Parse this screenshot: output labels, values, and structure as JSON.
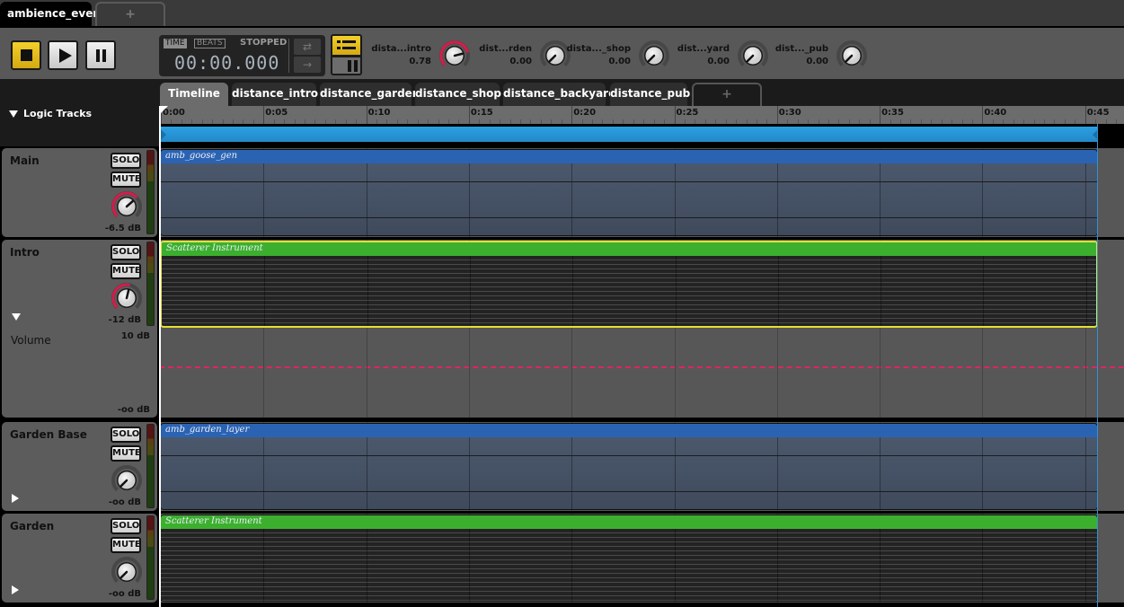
{
  "document_tabs": {
    "active": "ambience_event",
    "add_label": "+"
  },
  "transport": {
    "stop_icon": "stop-icon",
    "play_icon": "play-icon",
    "pause_icon": "pause-icon",
    "time_mode": "TIME",
    "beats_mode": "BEATS",
    "status": "STOPPED",
    "clock": "00:00.000",
    "loop_icon": "⇄",
    "forward_icon": "→"
  },
  "parameters": [
    {
      "name": "dista...intro",
      "value": "0.78",
      "fraction": 0.78,
      "active": true
    },
    {
      "name": "dist...rden",
      "value": "0.00",
      "fraction": 0.0,
      "active": false
    },
    {
      "name": "dista..._shop",
      "value": "0.00",
      "fraction": 0.0,
      "active": false
    },
    {
      "name": "dist...yard",
      "value": "0.00",
      "fraction": 0.0,
      "active": false
    },
    {
      "name": "dist..._pub",
      "value": "0.00",
      "fraction": 0.0,
      "active": false
    }
  ],
  "editor_tabs": [
    {
      "label": "Timeline",
      "active": true
    },
    {
      "label": "distance_intro"
    },
    {
      "label": "distance_garden"
    },
    {
      "label": "distance_shop"
    },
    {
      "label": "distance_backyard"
    },
    {
      "label": "distance_pub"
    },
    {
      "label": "+"
    }
  ],
  "logic_tracks_label": "Logic Tracks",
  "ruler": {
    "ticks": [
      "0:00",
      "0:05",
      "0:10",
      "0:15",
      "0:20",
      "0:25",
      "0:30",
      "0:35",
      "0:40",
      "0:45"
    ]
  },
  "tracks": [
    {
      "name": "Main",
      "solo": "SOLO",
      "mute": "MUTE",
      "volume": "-6.5 dB",
      "knob_fraction": 0.68,
      "expander": "none",
      "instrument": {
        "label": "amb_goose_gen",
        "kind": "audio"
      }
    },
    {
      "name": "Intro",
      "solo": "SOLO",
      "mute": "MUTE",
      "volume": "-12 dB",
      "knob_fraction": 0.55,
      "expander": "expanded",
      "instrument": {
        "label": "Scatterer Instrument",
        "kind": "scatterer",
        "selected": true
      }
    },
    {
      "name": "Garden Base",
      "solo": "SOLO",
      "mute": "MUTE",
      "volume": "-oo dB",
      "knob_fraction": 0.0,
      "expander": "collapsed",
      "instrument": {
        "label": "amb_garden_layer",
        "kind": "audio"
      }
    },
    {
      "name": "Garden",
      "solo": "SOLO",
      "mute": "MUTE",
      "volume": "-oo dB",
      "knob_fraction": 0.0,
      "expander": "collapsed",
      "instrument": {
        "label": "Scatterer Instrument",
        "kind": "scatterer"
      }
    }
  ],
  "automation": {
    "name": "Volume",
    "max": "10 dB",
    "min": "-oo dB"
  },
  "colors": {
    "accent_yellow": "#f4cf2a",
    "loop_blue": "#2ba0e2",
    "audio_blue": "#2b63b3",
    "scatterer_green": "#3cb02e",
    "automation_red": "#e0245e",
    "knob_arc": "#d81b4a"
  }
}
